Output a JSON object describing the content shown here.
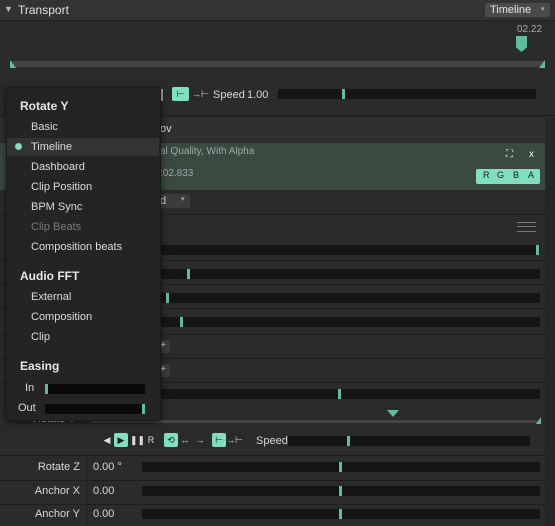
{
  "transport": {
    "title": "Transport",
    "mode_select": "Timeline",
    "time_marker": "02.22",
    "speed_label": "Speed",
    "speed_value": "1.00"
  },
  "clip": {
    "name_fragment": "ov",
    "info_fragment": "al Quality, With Alpha",
    "time_fragment": ":02.833",
    "channels": [
      "R",
      "G",
      "B",
      "A"
    ],
    "dropdown_fragment": "d"
  },
  "rotate_y_menu": {
    "title": "Rotate Y",
    "items": [
      {
        "label": "Basic",
        "selected": false,
        "disabled": false
      },
      {
        "label": "Timeline",
        "selected": true,
        "disabled": false
      },
      {
        "label": "Dashboard",
        "selected": false,
        "disabled": false
      },
      {
        "label": "Clip Position",
        "selected": false,
        "disabled": false
      },
      {
        "label": "BPM Sync",
        "selected": false,
        "disabled": false
      },
      {
        "label": "Clip Beats",
        "selected": false,
        "disabled": true
      },
      {
        "label": "Composition beats",
        "selected": false,
        "disabled": false
      }
    ],
    "audio_title": "Audio FFT",
    "audio_items": [
      "External",
      "Composition",
      "Clip"
    ],
    "easing_title": "Easing",
    "easing_in_label": "In",
    "easing_out_label": "Out",
    "easing_in_value": 0.0,
    "easing_out_value": 1.0
  },
  "timeline_controls": {
    "speed_label": "Speed",
    "plus": "+"
  },
  "params": [
    {
      "label": "Rotate Z",
      "value": "0.00 °",
      "level": 0.5
    },
    {
      "label": "Anchor X",
      "value": "0.00",
      "level": 0.5
    },
    {
      "label": "Anchor Y",
      "value": "0.00",
      "level": 0.5
    }
  ],
  "partial_label": "Rotate Y",
  "colors": {
    "accent": "#7fe0c0",
    "thumb": "#5fbf9a",
    "clip_bg": "#3a4a40"
  }
}
